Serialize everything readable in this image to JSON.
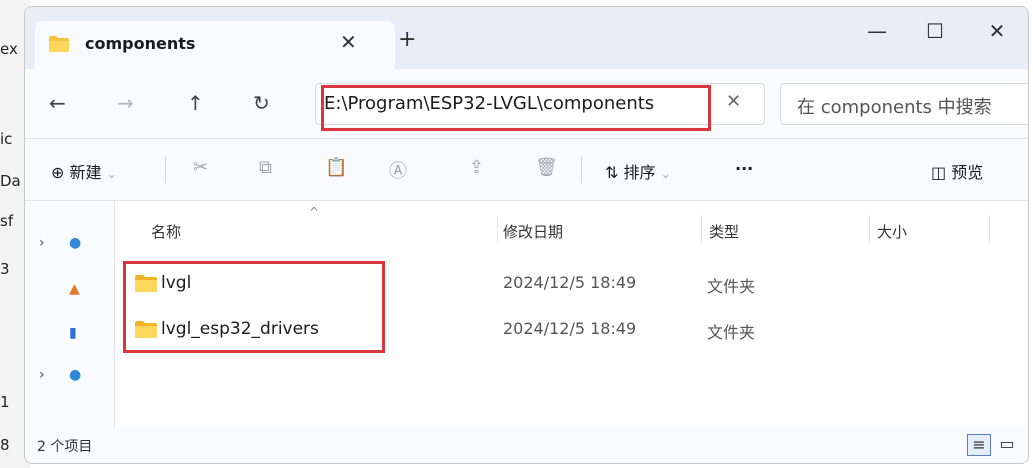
{
  "window": {
    "tab_title": "components",
    "tab_close_glyph": "✕",
    "new_tab_glyph": "+",
    "minimize_glyph": "—",
    "maximize_glyph": "☐",
    "close_glyph": "✕"
  },
  "nav": {
    "back_glyph": "←",
    "forward_glyph": "→",
    "up_glyph": "↑",
    "refresh_glyph": "↻",
    "address_value": "E:\\Program\\ESP32-LVGL\\components",
    "address_clear_glyph": "✕",
    "search_placeholder": "在 components 中搜索"
  },
  "toolbar": {
    "new_label": "新建",
    "new_icon": "⊕",
    "sort_label": "排序",
    "sort_icon": "⇅",
    "more_label": "···",
    "preview_label": "预览",
    "preview_icon": "◫",
    "cut_icon": "✂",
    "copy_icon": "⧉",
    "paste_icon": "📋",
    "rename_icon": "Ⓐ",
    "share_icon": "⇪",
    "delete_icon": "🗑"
  },
  "list": {
    "columns": [
      "名称",
      "修改日期",
      "类型",
      "大小"
    ],
    "rows": [
      {
        "name": "lvgl",
        "date": "2024/12/5 18:49",
        "type": "文件夹"
      },
      {
        "name": "lvgl_esp32_drivers",
        "date": "2024/12/5 18:49",
        "type": "文件夹"
      }
    ]
  },
  "status": {
    "item_count": "2 个项目"
  },
  "background": {
    "left_fragments": [
      "ex",
      "ic",
      "Da",
      "sf",
      "3",
      "1",
      "8"
    ]
  },
  "colors": {
    "highlight": "#d9363e",
    "folder": "#f5c542"
  }
}
